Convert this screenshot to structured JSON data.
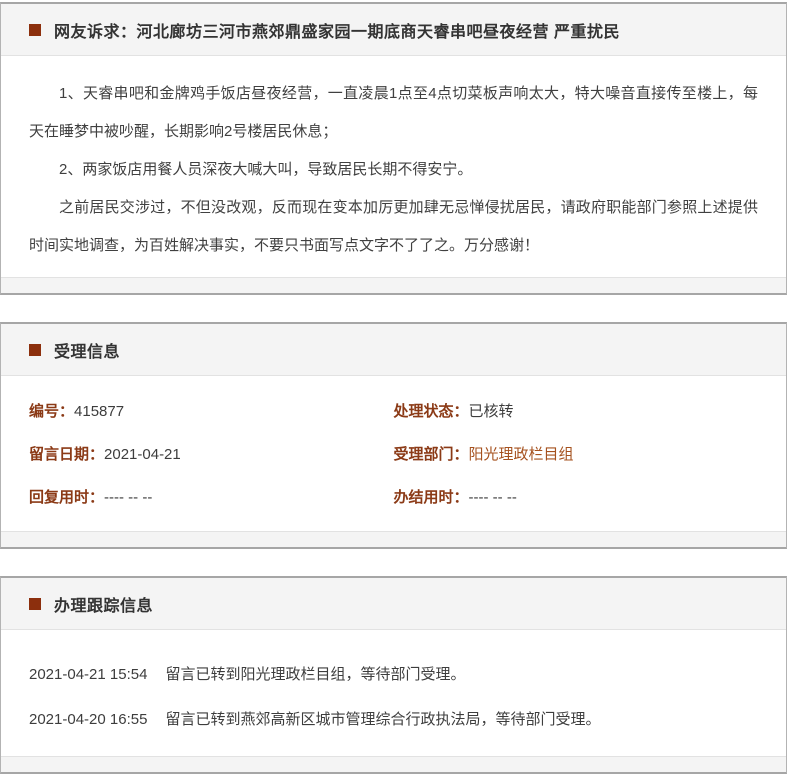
{
  "theme": {
    "bullet_color": "#8c2f0d",
    "label_color": "#8b3a16",
    "highlight_link_color": "#a5511e",
    "header_bg": "#f4f4f4",
    "panel_border_color": "#a6a6a6",
    "body_text_color": "#404040"
  },
  "complaint": {
    "title": "网友诉求：河北廊坊三河市燕郊鼎盛家园一期底商天睿串吧昼夜经营 严重扰民",
    "paragraphs": [
      "1、天睿串吧和金牌鸡手饭店昼夜经营，一直凌晨1点至4点切菜板声响太大，特大噪音直接传至楼上，每天在睡梦中被吵醒，长期影响2号楼居民休息；",
      "2、两家饭店用餐人员深夜大喊大叫，导致居民长期不得安宁。",
      "之前居民交涉过，不但没改观，反而现在变本加厉更加肆无忌惮侵扰居民，请政府职能部门参照上述提供时间实地调查，为百姓解决事实，不要只书面写点文字不了了之。万分感谢！"
    ]
  },
  "acceptance": {
    "title": "受理信息",
    "fields": [
      {
        "label": "编号：",
        "value": "415877"
      },
      {
        "label": "处理状态：",
        "value": "已核转"
      },
      {
        "label": "留言日期：",
        "value": "2021-04-21"
      },
      {
        "label": "受理部门：",
        "value": "阳光理政栏目组"
      },
      {
        "label": "回复用时：",
        "value": "---- -- --"
      },
      {
        "label": "办结用时：",
        "value": "---- -- --"
      }
    ]
  },
  "tracking": {
    "title": "办理跟踪信息",
    "entries": [
      {
        "time": "2021-04-21 15:54",
        "message": "留言已转到阳光理政栏目组，等待部门受理。"
      },
      {
        "time": "2021-04-20 16:55",
        "message": "留言已转到燕郊高新区城市管理综合行政执法局，等待部门受理。"
      }
    ]
  }
}
